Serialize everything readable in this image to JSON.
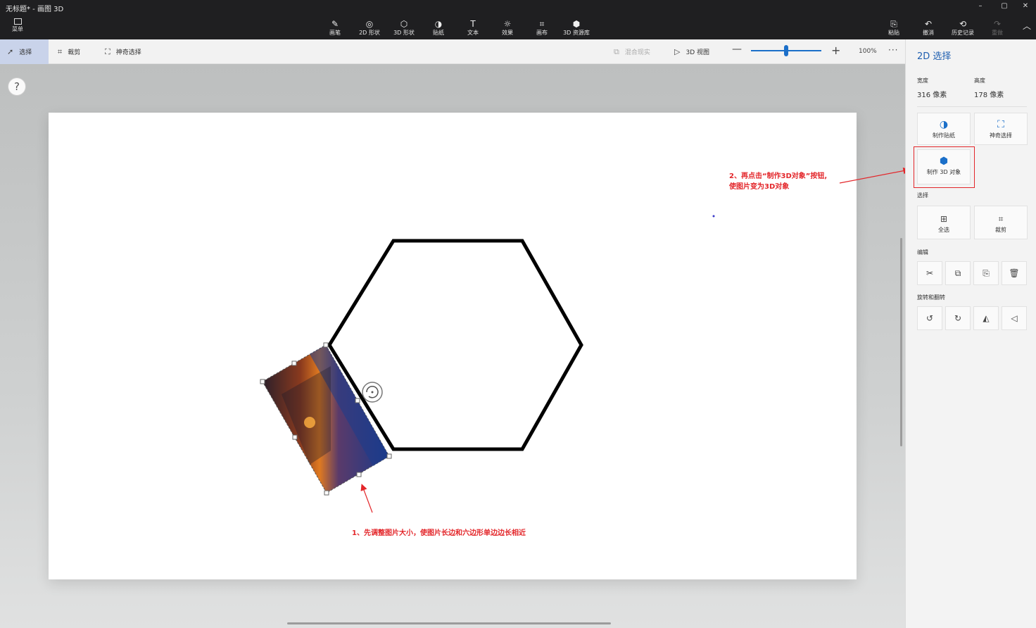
{
  "window": {
    "title": "无标题* - 画图 3D",
    "minimize": "–",
    "restore": "▢",
    "close": "✕"
  },
  "topbar": {
    "menu_label": "菜单",
    "tools": [
      {
        "label": "画笔",
        "icon": "brush-icon",
        "glyph": "✎"
      },
      {
        "label": "2D 形状",
        "icon": "2d-shapes-icon",
        "glyph": "◎"
      },
      {
        "label": "3D 形状",
        "icon": "3d-shapes-icon",
        "glyph": "⬡"
      },
      {
        "label": "贴纸",
        "icon": "sticker-icon",
        "glyph": "◑"
      },
      {
        "label": "文本",
        "icon": "text-icon",
        "glyph": "T"
      },
      {
        "label": "效果",
        "icon": "effects-icon",
        "glyph": "☼"
      },
      {
        "label": "画布",
        "icon": "canvas-icon",
        "glyph": "⌗"
      },
      {
        "label": "3D 资源库",
        "icon": "3d-library-icon",
        "glyph": "⬢"
      }
    ],
    "right_tools": [
      {
        "label": "粘贴",
        "icon": "paste-icon",
        "glyph": "⎘"
      },
      {
        "label": "撤消",
        "icon": "undo-icon",
        "glyph": "↶"
      },
      {
        "label": "历史记录",
        "icon": "history-icon",
        "glyph": "⟲"
      },
      {
        "label": "重做",
        "icon": "redo-icon",
        "glyph": "↷"
      }
    ],
    "collapse_glyph": "︿"
  },
  "subbar": {
    "select": "选择",
    "crop": "裁剪",
    "magic_select": "神奇选择",
    "mixed_reality": "混合现实",
    "view_3d": "3D 视图",
    "zoom_minus": "—",
    "zoom_plus": "+",
    "zoom": "100%",
    "more": "···",
    "zoom_level_fraction": 0.47
  },
  "workspace": {
    "help": "?",
    "annotation_1": "1、先调整图片大小，使图片长边和六边形单边边长相近",
    "annotation_2_line1": "2、再点击“制作3D对象”按钮,",
    "annotation_2_line2": "使图片变为3D对象"
  },
  "panel": {
    "title": "2D 选择",
    "width_label": "宽度",
    "width_value": "316 像素",
    "height_label": "高度",
    "height_value": "178 像素",
    "make_sticker": "制作贴纸",
    "magic_select": "神奇选择",
    "make_3d": "制作 3D 对象",
    "select_section": "选择",
    "select_all": "全选",
    "crop": "裁剪",
    "edit_section": "编辑",
    "rotate_section": "旋转和翻转"
  },
  "colors": {
    "accent": "#1b6fc9",
    "annotation": "#e3262a",
    "topbar": "#1f1f21"
  }
}
